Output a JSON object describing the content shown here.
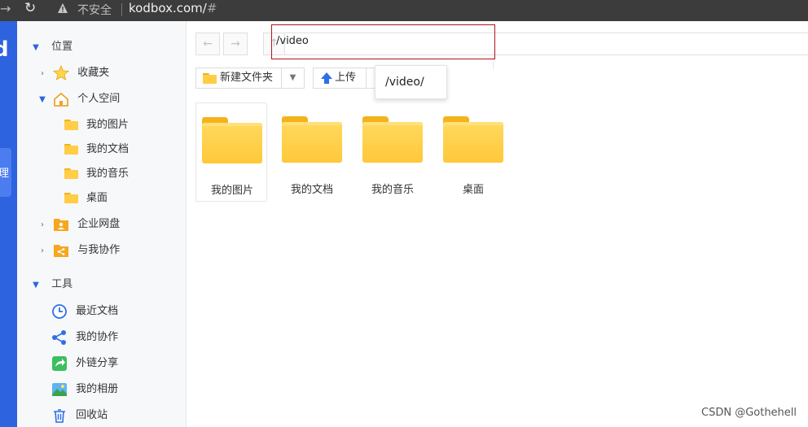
{
  "browser": {
    "insecure_label": "不安全",
    "url": "kodbox.com/",
    "url_hash": "#"
  },
  "rail": {
    "logo": "d",
    "active_label": "理"
  },
  "sidebar": {
    "location": "位置",
    "favorites": "收藏夹",
    "personal_space": "个人空间",
    "personal_children": [
      "我的图片",
      "我的文档",
      "我的音乐",
      "桌面"
    ],
    "enterprise_disk": "企业网盘",
    "collab_with_me": "与我协作",
    "tools": "工具",
    "tool_items": [
      "最近文档",
      "我的协作",
      "外链分享",
      "我的相册",
      "回收站"
    ]
  },
  "toolbar": {
    "path_value": "/video",
    "new_folder": "新建文件夹",
    "upload": "上传",
    "suggestion": "/video/"
  },
  "files": [
    "我的图片",
    "我的文档",
    "我的音乐",
    "桌面"
  ],
  "watermark": "CSDN @Gothehell",
  "colors": {
    "rail": "#2e63e0",
    "folder": "#ffcd46",
    "highlight_border": "#b0151c"
  }
}
